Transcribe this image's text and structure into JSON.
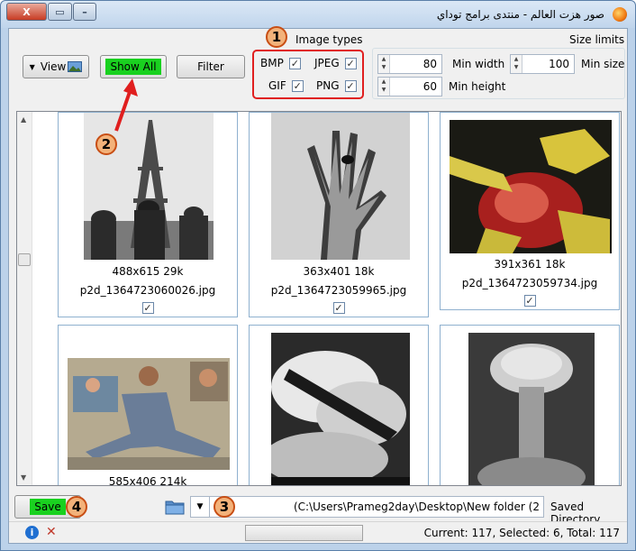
{
  "window": {
    "title": "صور هزت العالم - منتدى برامج توداي",
    "controls": {
      "close": "X",
      "maximize": "▭",
      "minimize": "–"
    }
  },
  "toolbar": {
    "view_label": "View",
    "show_all_label": "Show All",
    "filter_label": "Filter"
  },
  "image_types": {
    "title": "Image types",
    "items": [
      {
        "label": "BMP",
        "checked": true
      },
      {
        "label": "JPEG",
        "checked": true
      },
      {
        "label": "GIF",
        "checked": true
      },
      {
        "label": "PNG",
        "checked": true
      }
    ]
  },
  "size_limits": {
    "title": "Size limits",
    "min_width_label": "Min width",
    "min_width_value": "80",
    "min_size_label": "Min size",
    "min_size_value": "100",
    "min_height_label": "Min height",
    "min_height_value": "60"
  },
  "images": [
    {
      "info": "488x615 29k",
      "filename": "p2d_1364723060026.jpg",
      "checked": true
    },
    {
      "info": "363x401 18k",
      "filename": "p2d_1364723059965.jpg",
      "checked": true
    },
    {
      "info": "391x361 18k",
      "filename": "p2d_1364723059734.jpg",
      "checked": true
    },
    {
      "info": "585x406 214k",
      "filename": "",
      "checked": true
    },
    {
      "info": "",
      "filename": "",
      "checked": true
    },
    {
      "info": "",
      "filename": "",
      "checked": true
    }
  ],
  "footer": {
    "save_label": "Save",
    "path_value": "(C:\\Users\\Prameg2day\\Desktop\\New folder (2",
    "saved_directory_label": "Saved Directory"
  },
  "status": {
    "text": "Current: 117, Selected: 6, Total: 117"
  },
  "markers": [
    "1",
    "2",
    "3",
    "4"
  ],
  "colors": {
    "accent_green": "#19d11f",
    "highlight_red": "#e01f1f"
  }
}
